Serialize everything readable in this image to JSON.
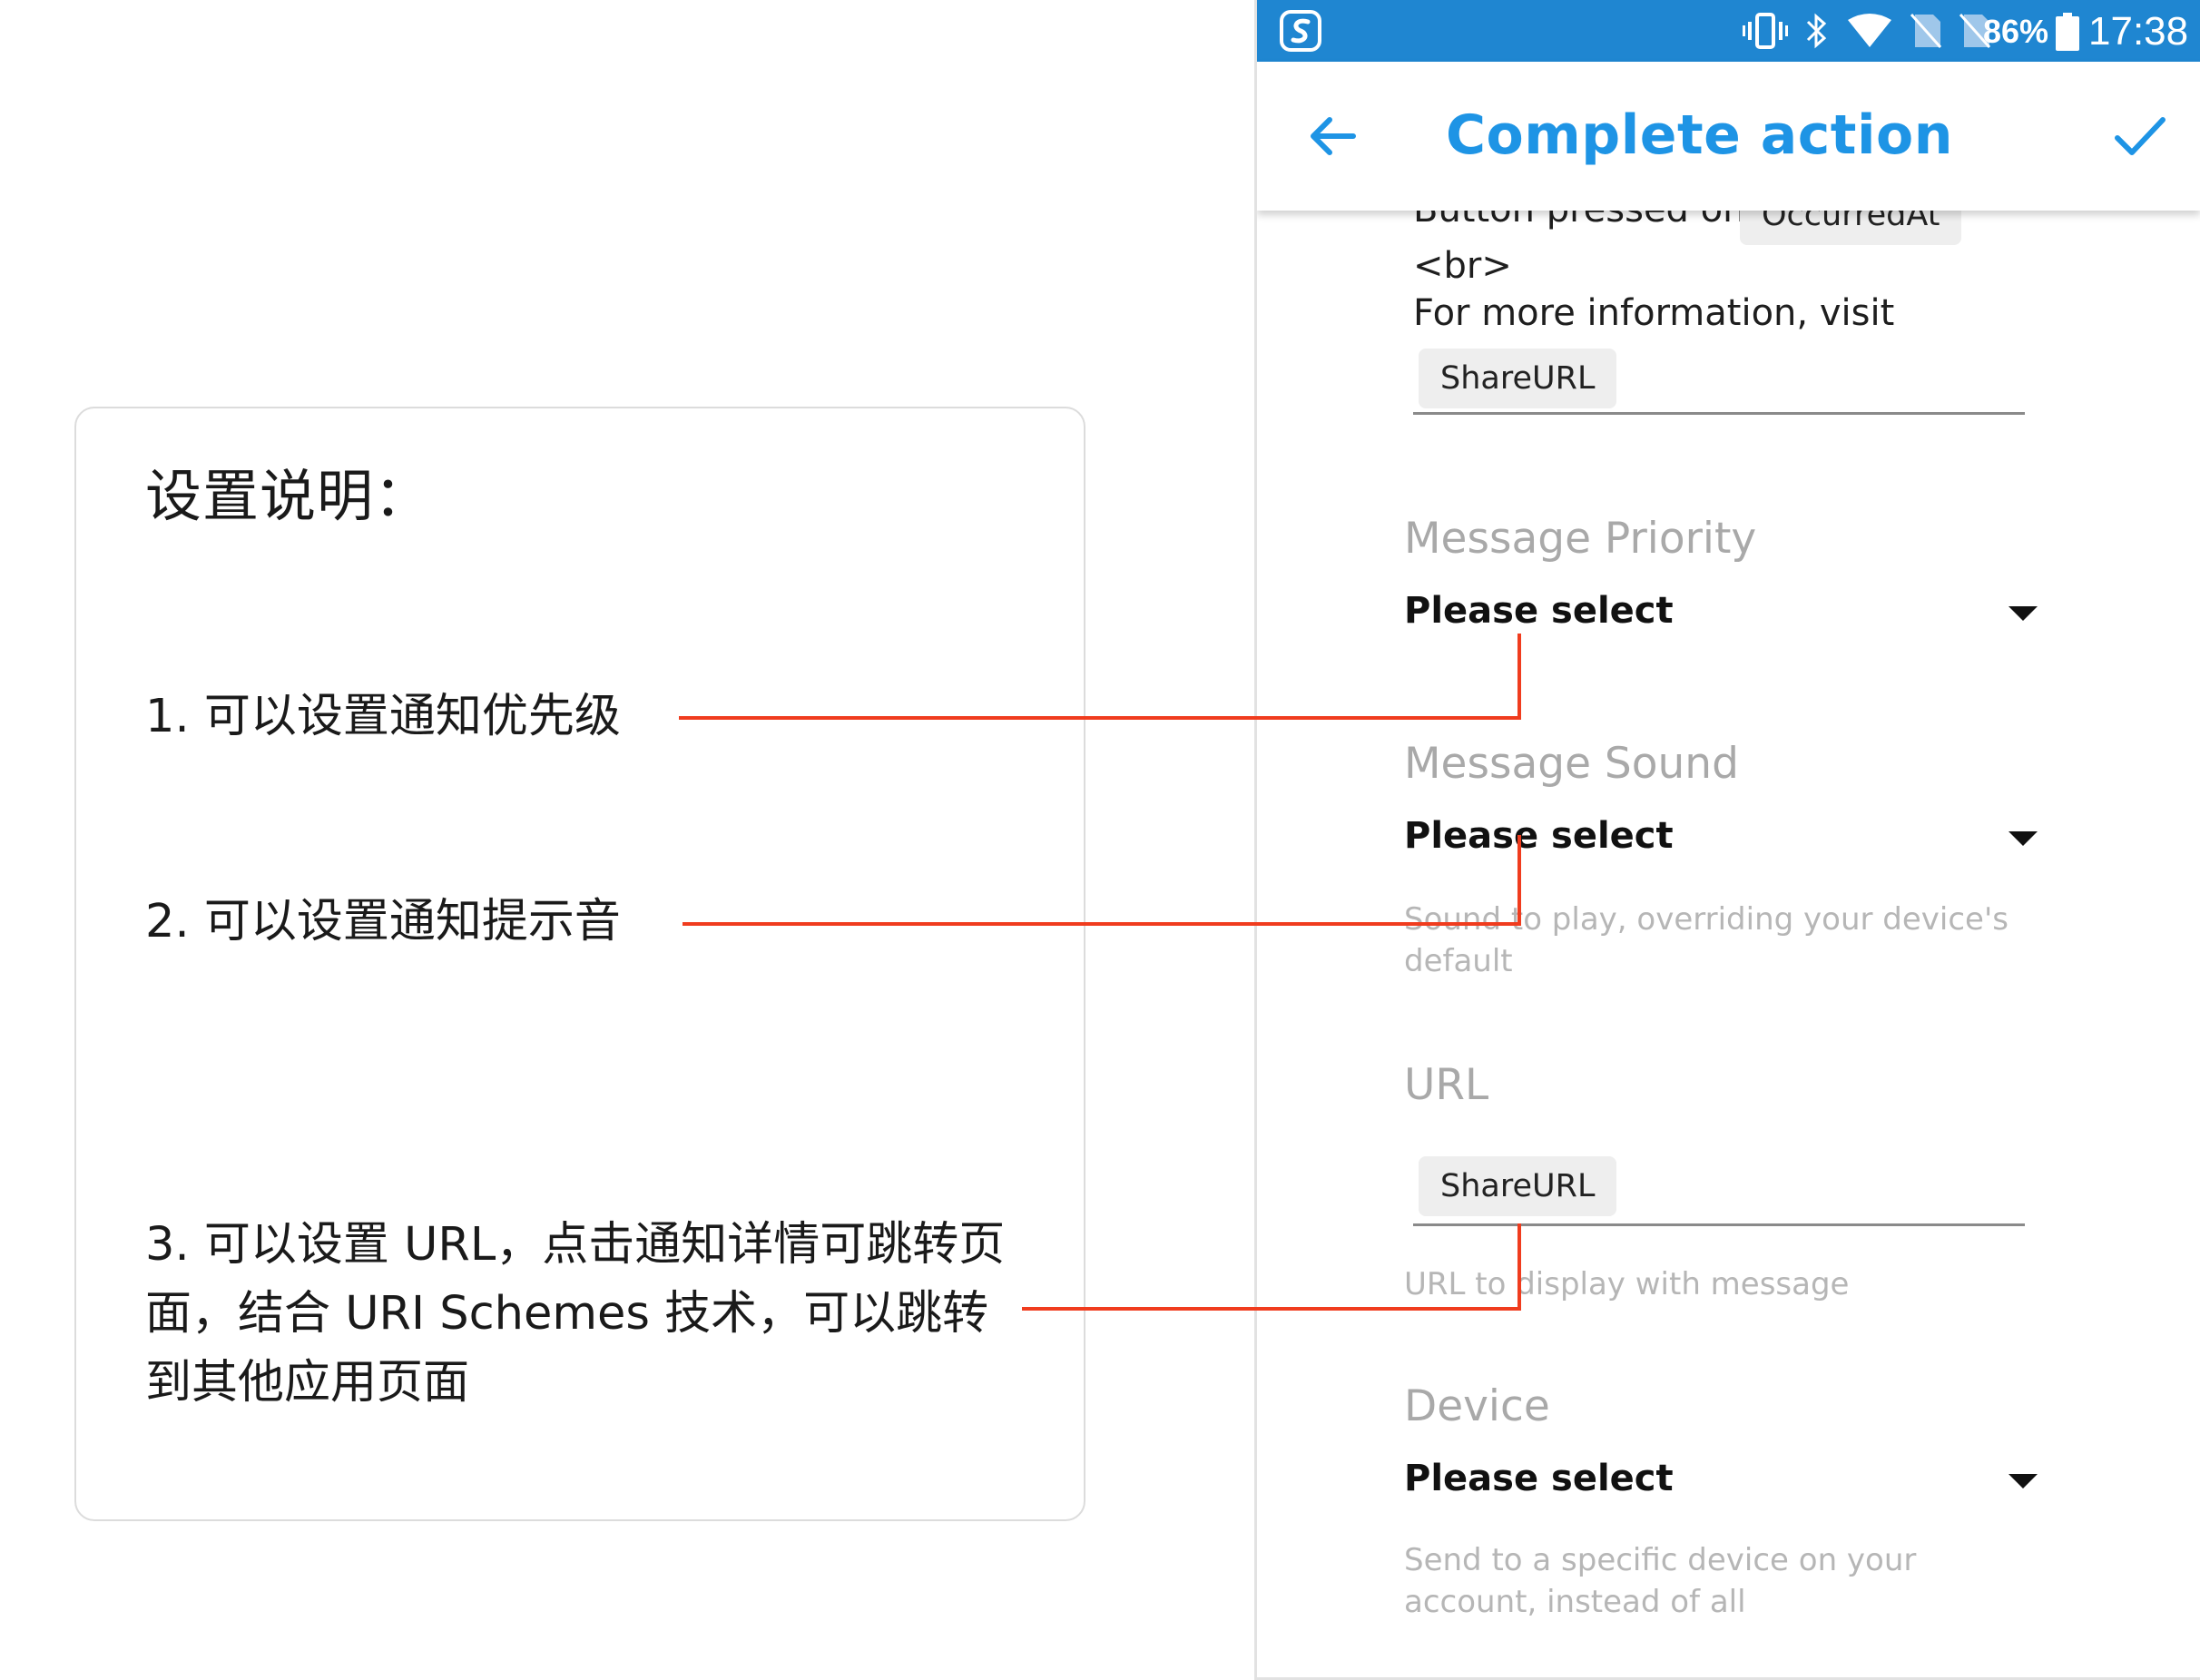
{
  "annotation": {
    "title": "设置说明：",
    "items": [
      "1. 可以设置通知优先级",
      "2. 可以设置通知提示音",
      "3. 可以设置 URL，点击通知详情可跳转页面，结合 URI Schemes 技术，可以跳转到其他应用页面"
    ]
  },
  "status_bar": {
    "battery": "86%",
    "time": "17:38",
    "icons": [
      "vibrate-icon",
      "bluetooth-icon",
      "wifi-icon",
      "no-sim-icon",
      "no-sim-icon",
      "battery-icon"
    ]
  },
  "app_bar": {
    "title": "Complete action",
    "back_icon": "arrow-left-icon",
    "confirm_icon": "checkmark-icon"
  },
  "message_body": {
    "line_partial": "Button pressed on",
    "chip_occurred": "OccurredAt",
    "line_br": "<br>",
    "line_info": "For more information, visit",
    "chip_shareurl": "ShareURL"
  },
  "fields": {
    "priority": {
      "label": "Message Priority",
      "value": "Please select"
    },
    "sound": {
      "label": "Message Sound",
      "value": "Please select",
      "helper": "Sound to play, overriding your device's default"
    },
    "url": {
      "label": "URL",
      "chip": "ShareURL",
      "helper": "URL to display with message"
    },
    "device": {
      "label": "Device",
      "value": "Please select",
      "helper": "Send to a specific device on your account, instead of all"
    }
  },
  "colors": {
    "accent": "#1e94e5",
    "status_bar": "#1f86d1",
    "connector": "#f03c1e"
  }
}
